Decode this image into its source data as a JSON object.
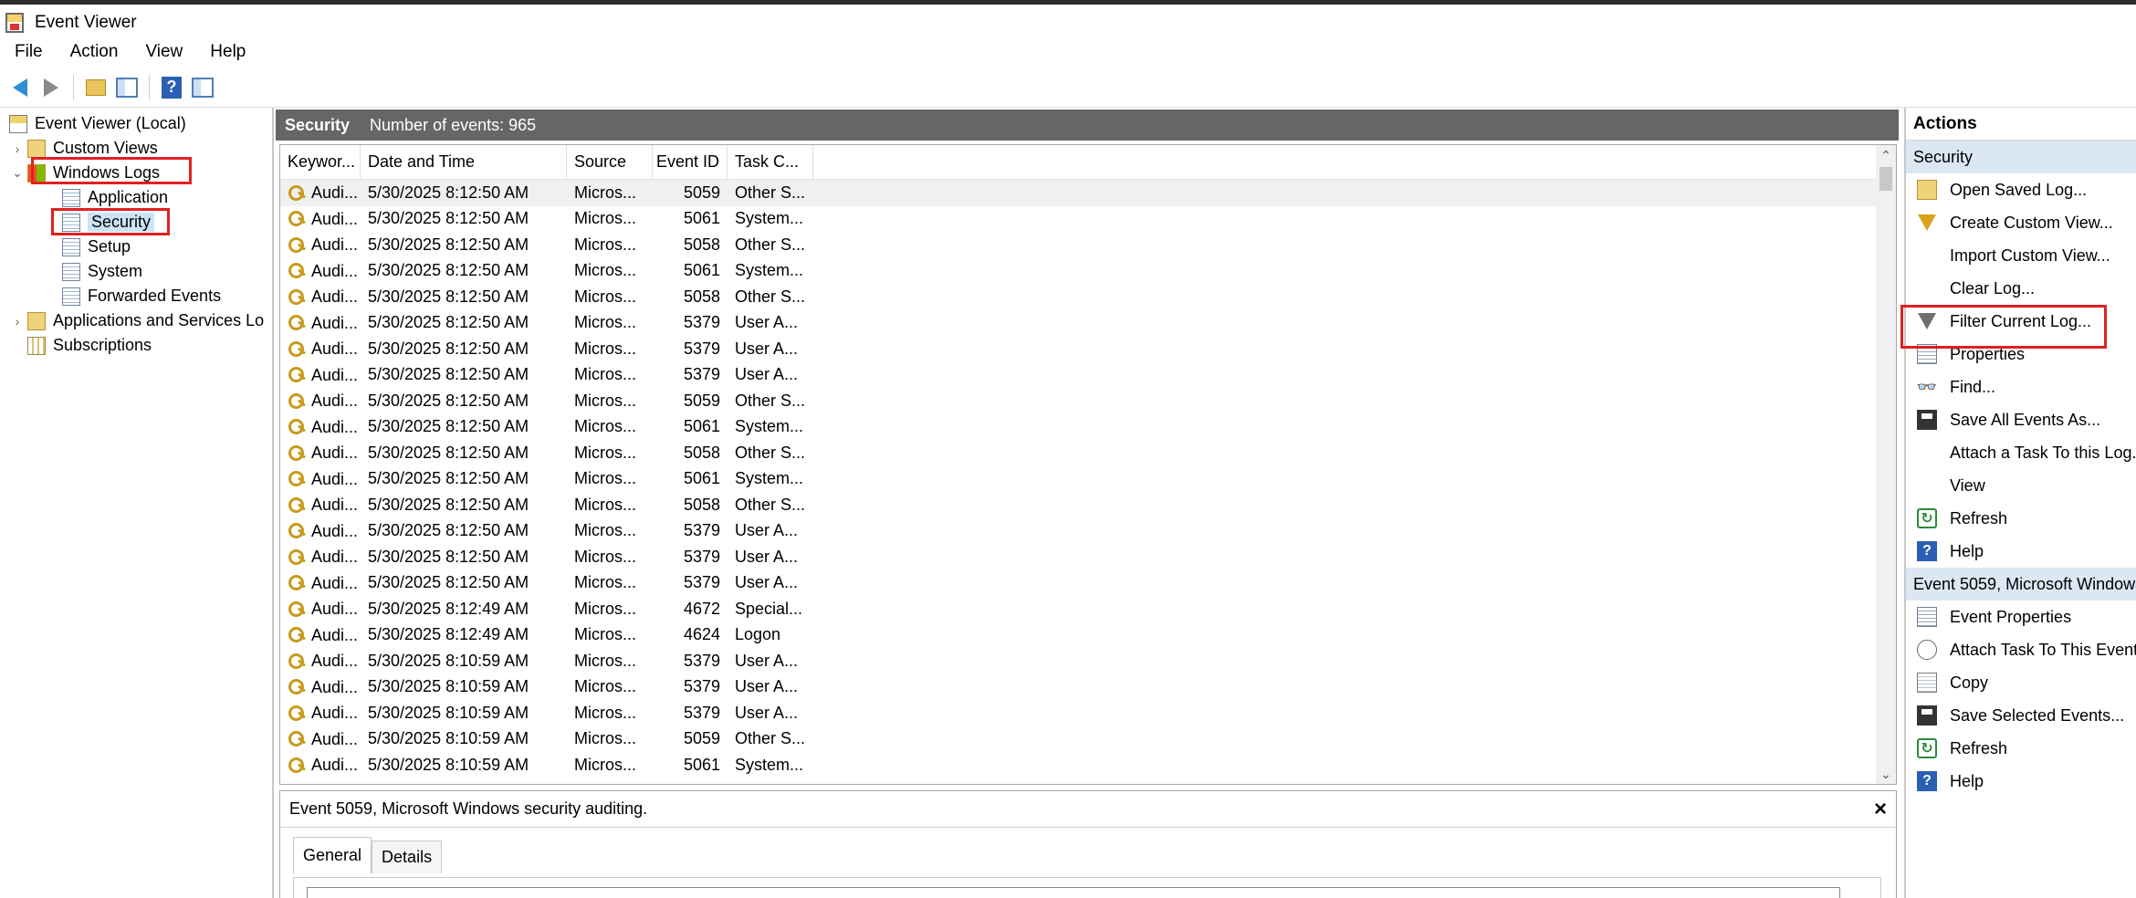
{
  "window": {
    "title": "Event Viewer"
  },
  "menu": [
    "File",
    "Action",
    "View",
    "Help"
  ],
  "tree": {
    "root": "Event Viewer (Local)",
    "custom_views": "Custom Views",
    "windows_logs": "Windows Logs",
    "children": [
      "Application",
      "Security",
      "Setup",
      "System",
      "Forwarded Events"
    ],
    "apps_services": "Applications and Services Lo",
    "subscriptions": "Subscriptions"
  },
  "center": {
    "log_name": "Security",
    "event_count": "Number of events: 965",
    "columns": [
      "Keywor...",
      "Date and Time",
      "Source",
      "Event ID",
      "Task C..."
    ],
    "rows": [
      [
        "Audi...",
        "5/30/2025 8:12:50 AM",
        "Micros...",
        "5059",
        "Other S..."
      ],
      [
        "Audi...",
        "5/30/2025 8:12:50 AM",
        "Micros...",
        "5061",
        "System..."
      ],
      [
        "Audi...",
        "5/30/2025 8:12:50 AM",
        "Micros...",
        "5058",
        "Other S..."
      ],
      [
        "Audi...",
        "5/30/2025 8:12:50 AM",
        "Micros...",
        "5061",
        "System..."
      ],
      [
        "Audi...",
        "5/30/2025 8:12:50 AM",
        "Micros...",
        "5058",
        "Other S..."
      ],
      [
        "Audi...",
        "5/30/2025 8:12:50 AM",
        "Micros...",
        "5379",
        "User A..."
      ],
      [
        "Audi...",
        "5/30/2025 8:12:50 AM",
        "Micros...",
        "5379",
        "User A..."
      ],
      [
        "Audi...",
        "5/30/2025 8:12:50 AM",
        "Micros...",
        "5379",
        "User A..."
      ],
      [
        "Audi...",
        "5/30/2025 8:12:50 AM",
        "Micros...",
        "5059",
        "Other S..."
      ],
      [
        "Audi...",
        "5/30/2025 8:12:50 AM",
        "Micros...",
        "5061",
        "System..."
      ],
      [
        "Audi...",
        "5/30/2025 8:12:50 AM",
        "Micros...",
        "5058",
        "Other S..."
      ],
      [
        "Audi...",
        "5/30/2025 8:12:50 AM",
        "Micros...",
        "5061",
        "System..."
      ],
      [
        "Audi...",
        "5/30/2025 8:12:50 AM",
        "Micros...",
        "5058",
        "Other S..."
      ],
      [
        "Audi...",
        "5/30/2025 8:12:50 AM",
        "Micros...",
        "5379",
        "User A..."
      ],
      [
        "Audi...",
        "5/30/2025 8:12:50 AM",
        "Micros...",
        "5379",
        "User A..."
      ],
      [
        "Audi...",
        "5/30/2025 8:12:50 AM",
        "Micros...",
        "5379",
        "User A..."
      ],
      [
        "Audi...",
        "5/30/2025 8:12:49 AM",
        "Micros...",
        "4672",
        "Special..."
      ],
      [
        "Audi...",
        "5/30/2025 8:12:49 AM",
        "Micros...",
        "4624",
        "Logon"
      ],
      [
        "Audi...",
        "5/30/2025 8:10:59 AM",
        "Micros...",
        "5379",
        "User A..."
      ],
      [
        "Audi...",
        "5/30/2025 8:10:59 AM",
        "Micros...",
        "5379",
        "User A..."
      ],
      [
        "Audi...",
        "5/30/2025 8:10:59 AM",
        "Micros...",
        "5379",
        "User A..."
      ],
      [
        "Audi...",
        "5/30/2025 8:10:59 AM",
        "Micros...",
        "5059",
        "Other S..."
      ],
      [
        "Audi...",
        "5/30/2025 8:10:59 AM",
        "Micros...",
        "5061",
        "System..."
      ]
    ]
  },
  "detail": {
    "title": "Event 5059, Microsoft Windows security auditing.",
    "close": "×",
    "tabs": [
      "General",
      "Details"
    ]
  },
  "actions": {
    "header": "Actions",
    "section1": "Security",
    "items1": [
      "Open Saved Log...",
      "Create Custom View...",
      "Import Custom View...",
      "Clear Log...",
      "Filter Current Log...",
      "Properties",
      "Find...",
      "Save All Events As...",
      "Attach a Task To this Log...",
      "View",
      "Refresh",
      "Help"
    ],
    "section2": "Event 5059, Microsoft Windows",
    "items2": [
      "Event Properties",
      "Attach Task To This Event...",
      "Copy",
      "Save Selected Events...",
      "Refresh",
      "Help"
    ]
  },
  "icons": {
    "help_glyph": "?",
    "refresh_glyph": "↻",
    "find_glyph": "👓",
    "caret_right": "›",
    "caret_down": "⌄",
    "scroll_up": "⌃",
    "scroll_down": "⌄"
  },
  "colors": {
    "highlight": "#e02020",
    "header_bg": "#666666",
    "section_bg": "#dbe7f3"
  }
}
